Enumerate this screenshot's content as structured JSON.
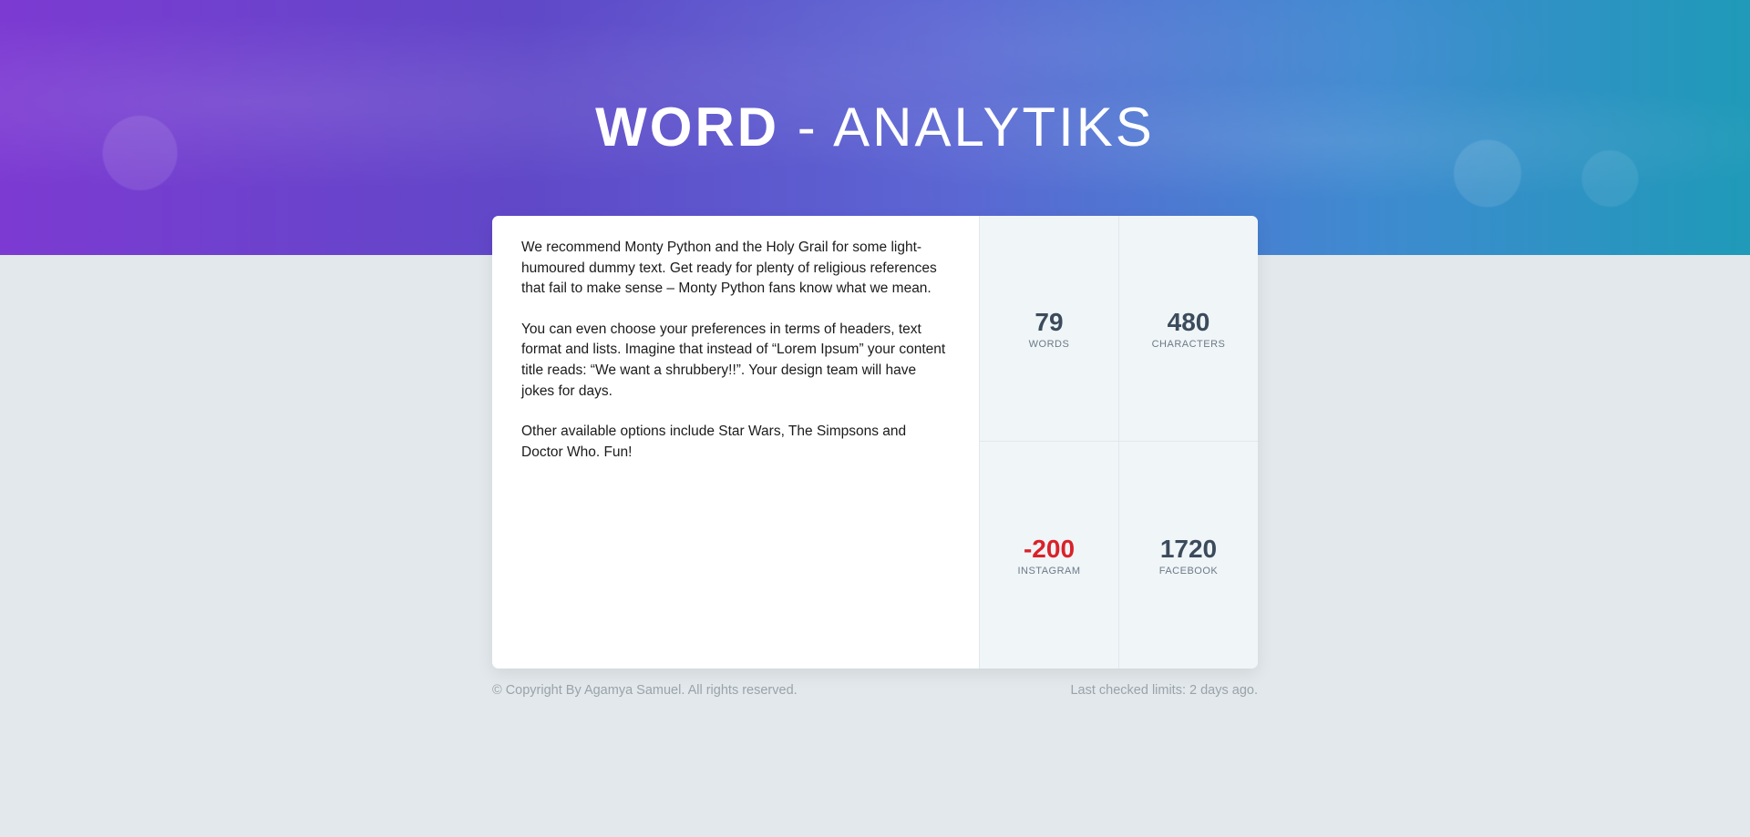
{
  "header": {
    "title_bold": "WORD",
    "title_rest": " - ANALYTIKS"
  },
  "content": {
    "paragraphs": [
      "We recommend Monty Python and the Holy Grail for some light-humoured dummy text. Get ready for plenty of religious references that fail to make sense – Monty Python fans know what we mean.",
      "You can even choose your preferences in terms of headers, text format and lists. Imagine that instead of “Lorem Ipsum” your content title reads: “We want a shrubbery!!”. Your design team will have jokes for days.",
      "Other available options include Star Wars, The Simpsons and Doctor Who. Fun!"
    ]
  },
  "stats": [
    {
      "value": "79",
      "label": "WORDS"
    },
    {
      "value": "480",
      "label": "CHARACTERS"
    },
    {
      "value": "-200",
      "label": "INSTAGRAM"
    },
    {
      "value": "1720",
      "label": "FACEBOOK"
    }
  ],
  "footer": {
    "copyright": "© Copyright By Agamya Samuel. All rights reserved.",
    "last_checked": "Last checked limits: 2 days ago."
  },
  "colors": {
    "negative": "#d9222a",
    "stat_value": "#3b4b5c"
  }
}
